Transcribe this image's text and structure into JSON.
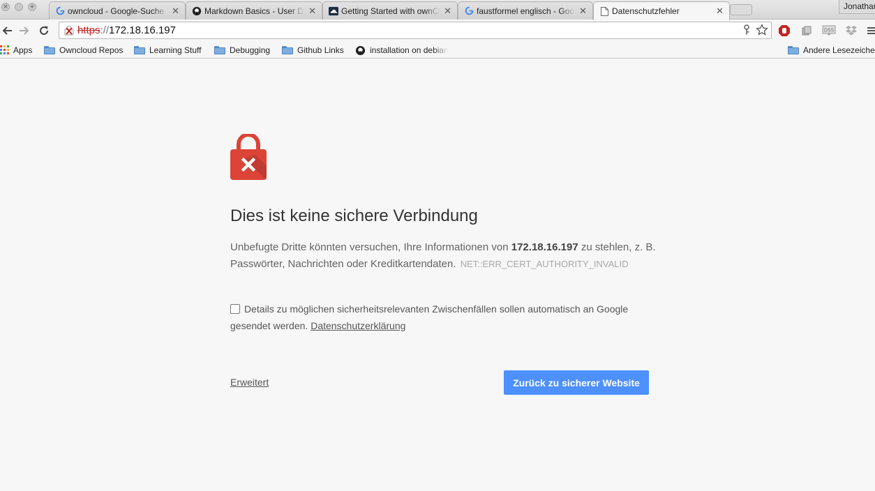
{
  "tabs": [
    {
      "title": "owncloud - Google-Suche",
      "favicon": "google-icon",
      "active": false
    },
    {
      "title": "Markdown Basics - User Do",
      "favicon": "github-icon",
      "active": false
    },
    {
      "title": "Getting Started with ownCl",
      "favicon": "owncloud-icon",
      "active": false
    },
    {
      "title": "faustformel englisch - Goo",
      "favicon": "google-icon",
      "active": false
    },
    {
      "title": "Datenschutzfehler",
      "favicon": "page-icon",
      "active": true
    }
  ],
  "profile_name": "Jonathan",
  "address": {
    "scheme": "https",
    "separator": "://",
    "host": "172.18.16.197"
  },
  "bookmarks": [
    {
      "label": "Apps",
      "icon": "apps-grid-icon"
    },
    {
      "label": "Owncloud Repos",
      "icon": "folder-icon"
    },
    {
      "label": "Learning Stuff",
      "icon": "folder-icon"
    },
    {
      "label": "Debugging",
      "icon": "folder-icon"
    },
    {
      "label": "Github Links",
      "icon": "folder-icon"
    },
    {
      "label": "installation on debian",
      "icon": "github-icon"
    },
    {
      "label": "Andere Lesezeichen",
      "icon": "folder-icon"
    }
  ],
  "interstitial": {
    "heading": "Dies ist keine sichere Verbindung",
    "explanation_pre": "Unbefugte Dritte könnten versuchen, Ihre Informationen von ",
    "explanation_host": "172.18.16.197",
    "explanation_post": " zu stehlen, z. B. Passwörter, Nachrichten oder Kreditkartendaten.",
    "error_code": "NET::ERR_CERT_AUTHORITY_INVALID",
    "checkbox_text": "Details zu möglichen sicherheitsrelevanten Zwischenfällen sollen automatisch an Google gesendet werden.",
    "privacy_link": "Datenschutzerklärung",
    "advanced_link": "Erweitert",
    "back_button": "Zurück zu sicherer Website"
  },
  "colors": {
    "danger": "#db4437",
    "primary_button": "#4d90fe",
    "scheme_strike": "#c5221f"
  }
}
